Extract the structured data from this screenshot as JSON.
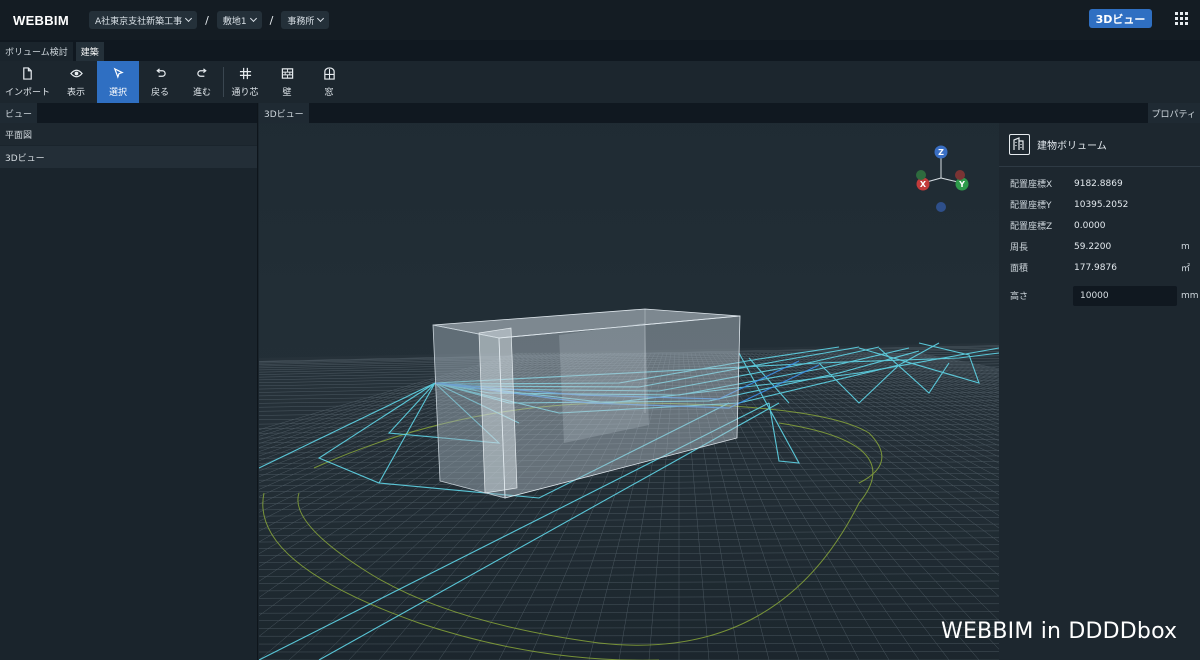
{
  "app": {
    "logo": "WEBBIM"
  },
  "breadcrumb": [
    {
      "label": "A社東京支社新築工事"
    },
    {
      "label": "敷地1"
    },
    {
      "label": "事務所"
    }
  ],
  "breadcrumb_separator": "/",
  "view_mode_badge": "3Dビュー",
  "tabs": [
    {
      "label": "ボリューム検討",
      "active": false
    },
    {
      "label": "建築",
      "active": true
    }
  ],
  "toolbar": {
    "import": "インポート",
    "show": "表示",
    "select": "選択",
    "back": "戻る",
    "forward": "進む",
    "grid": "通り芯",
    "wall": "壁",
    "window": "窓"
  },
  "left_panel": {
    "tab": "ビュー",
    "items": [
      "平面図",
      "3Dビュー"
    ]
  },
  "viewport": {
    "tab": "3Dビュー",
    "gizmo": {
      "z": "Z",
      "x": "X",
      "y": "Y"
    }
  },
  "right_panel": {
    "tab": "プロパティ",
    "title": "建物ボリューム",
    "props": [
      {
        "label": "配置座標X",
        "value": "9182.8869",
        "unit": ""
      },
      {
        "label": "配置座標Y",
        "value": "10395.2052",
        "unit": ""
      },
      {
        "label": "配置座標Z",
        "value": "0.0000",
        "unit": ""
      },
      {
        "label": "周長",
        "value": "59.2200",
        "unit": "m"
      },
      {
        "label": "面積",
        "value": "177.9876",
        "unit": "㎡"
      }
    ],
    "height": {
      "label": "高さ",
      "value": "10000",
      "unit": "mm"
    }
  },
  "caption": "WEBBIM in DDDDbox",
  "colors": {
    "accent": "#2f6fc2",
    "wire": "#5fd6e8",
    "boundary": "#8fae3a"
  }
}
